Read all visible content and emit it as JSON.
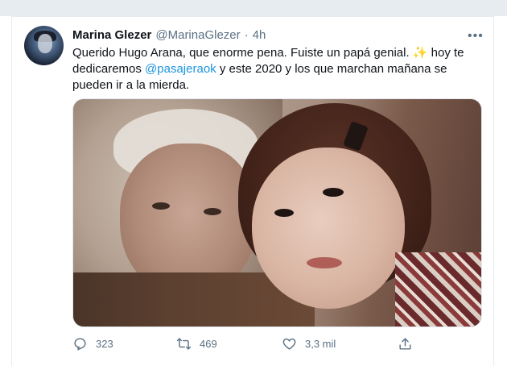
{
  "tweet": {
    "author_name": "Marina Glezer",
    "author_handle": "@MarinaGlezer",
    "separator": "·",
    "time": "4h",
    "more_label": "•••",
    "text_part1": "Querido Hugo Arana, que enorme pena. Fuiste un papá genial. ",
    "sparkle": "✨",
    "text_part2": " hoy te dedicaremos ",
    "mention": "@pasajeraok",
    "text_part3": " y este 2020 y los que marchan mañana se pueden ir a la mierda.",
    "has_media": true
  },
  "actions": {
    "reply_count": "323",
    "retweet_count": "469",
    "like_count": "3,3 mil",
    "reply_icon": "reply-icon",
    "retweet_icon": "retweet-icon",
    "like_icon": "heart-icon",
    "share_icon": "share-icon"
  },
  "colors": {
    "link": "#1b95e0",
    "secondary_text": "#5b7083",
    "background_strip": "#e6ecf0"
  }
}
